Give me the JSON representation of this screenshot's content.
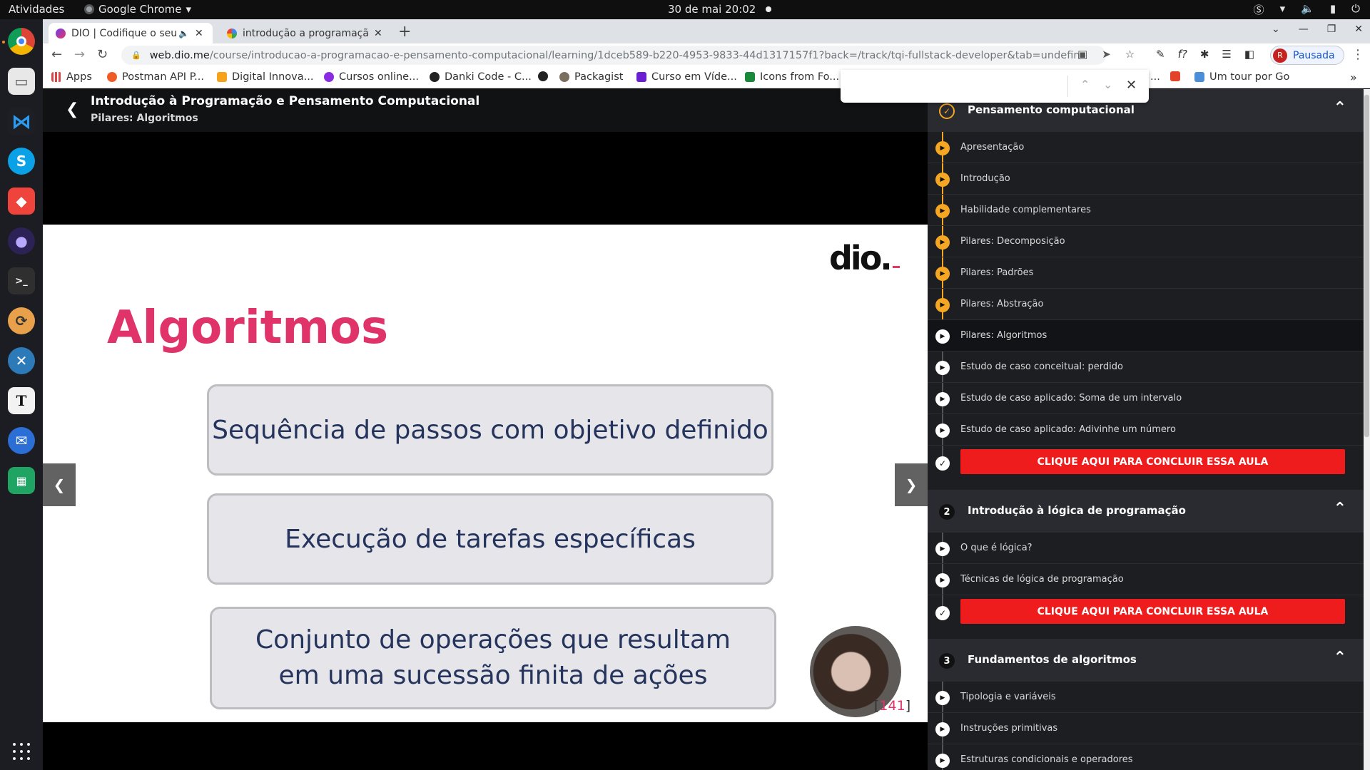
{
  "desktop": {
    "activities": "Atividades",
    "app_name": "Google Chrome",
    "clock": "30 de mai  20:02",
    "dock_items": [
      "chrome-icon",
      "files-icon",
      "vscode-icon",
      "skype-icon",
      "anydesk-icon",
      "eclipse-icon",
      "terminal-icon",
      "update-icon",
      "compass-icon",
      "typora-icon",
      "thunderbird-icon",
      "spreadsheet-icon"
    ]
  },
  "browser": {
    "tabs": [
      {
        "title": "DIO | Codifique o seu f",
        "active": true
      },
      {
        "title": "introdução a programaçã",
        "active": false
      }
    ],
    "url_host": "web.dio.me",
    "url_path": "/course/introducao-a-programacao-e-pensamento-computacional/learning/1dceb589-b220-4953-9833-44d1317157f1?back=/track/tqi-fullstack-developer&tab=undefined&moduleId=undefined",
    "profile_initial": "R",
    "profile_label": "Pausada",
    "bookmarks": [
      "Apps",
      "Postman API P...",
      "Digital Innova...",
      "Cursos online...",
      "Danki Code - C...",
      "",
      "Packagist",
      "Curso em Víde...",
      "Icons from Fo...",
      "...",
      "",
      "Um tour por Go"
    ]
  },
  "course": {
    "title": "Introdução à Programação e Pensamento Computacional",
    "subtitle": "Pilares: Algoritmos"
  },
  "slide": {
    "logo": "dio.",
    "heading": "Algoritmos",
    "boxes": [
      [
        "Sequência de passos com objetivo definido"
      ],
      [
        "Execução de tarefas específicas"
      ],
      [
        "Conjunto de operações que resultam",
        "em uma sucessão finita de ações"
      ]
    ],
    "page_bracket_open": "[",
    "page_number": "141",
    "page_bracket_close": "]"
  },
  "sidebar": {
    "modules": [
      {
        "badge": "✓",
        "title": "Pensamento computacional",
        "lessons": [
          "Apresentação",
          "Introdução",
          "Habilidade complementares",
          "Pilares: Decomposição",
          "Pilares: Padrões",
          "Pilares: Abstração",
          "Pilares: Algoritmos",
          "Estudo de caso conceitual: perdido",
          "Estudo de caso aplicado: Soma de um intervalo",
          "Estudo de caso aplicado: Adivinhe um número"
        ],
        "complete_label": "CLIQUE AQUI PARA CONCLUIR ESSA AULA"
      },
      {
        "badge": "2",
        "title": "Introdução à lógica de programação",
        "lessons": [
          "O que é lógica?",
          "Técnicas de lógica de programação"
        ],
        "complete_label": "CLIQUE AQUI PARA CONCLUIR ESSA AULA"
      },
      {
        "badge": "3",
        "title": "Fundamentos de algoritmos",
        "lessons": [
          "Tipologia e variáveis",
          "Instruções primitivas",
          "Estruturas condicionais e operadores"
        ]
      }
    ]
  },
  "colors": {
    "accent": "#f5a623",
    "complete_button": "#ee1c1c",
    "slide_heading": "#e0336a",
    "slide_text": "#24345c"
  }
}
